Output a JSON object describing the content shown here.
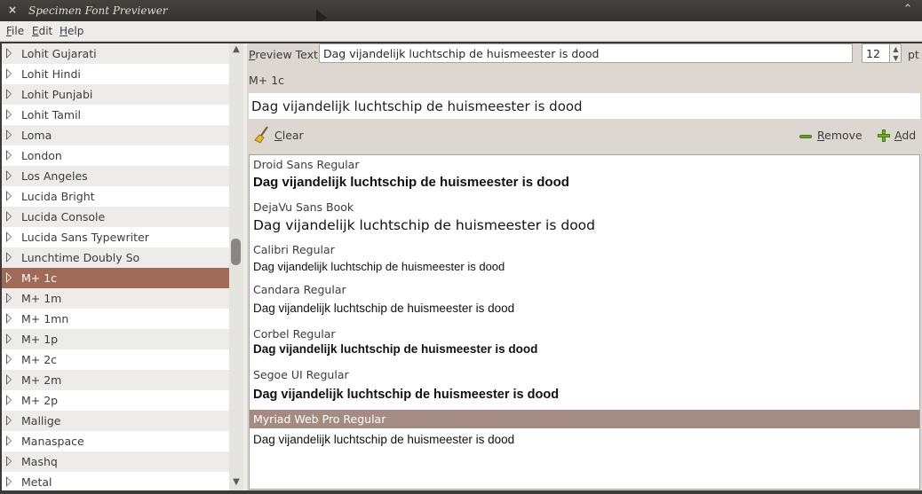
{
  "window": {
    "title": "Specimen Font Previewer",
    "close_glyph": "×",
    "maximize_glyph": "⌃"
  },
  "menubar": {
    "items": [
      {
        "first": "F",
        "rest": "ile"
      },
      {
        "first": "E",
        "rest": "dit"
      },
      {
        "first": "H",
        "rest": "elp"
      }
    ]
  },
  "font_list": {
    "items": [
      "Lohit Gujarati",
      "Lohit Hindi",
      "Lohit Punjabi",
      "Lohit Tamil",
      "Loma",
      "London",
      "Los Angeles",
      "Lucida Bright",
      "Lucida Console",
      "Lucida Sans Typewriter",
      "Lunchtime Doubly So",
      "M+ 1c",
      "M+ 1m",
      "M+ 1mn",
      "M+ 1p",
      "M+ 2c",
      "M+ 2m",
      "M+ 2p",
      "Mallige",
      "Manaspace",
      "Mashq",
      "Metal"
    ],
    "selected": "M+ 1c"
  },
  "preview": {
    "label_first": "P",
    "label_rest": "review Text:",
    "text": "Dag vijandelijk luchtschip de huismeester is dood",
    "size": "12",
    "unit": "pt",
    "selected_font": "M+ 1c",
    "sample": "Dag vijandelijk luchtschip de huismeester is dood"
  },
  "toolbar": {
    "clear_first": "C",
    "clear_rest": "lear",
    "remove_first": "R",
    "remove_rest": "emove",
    "add_first": "A",
    "add_rest": "dd",
    "clear_icon": "broom-icon",
    "remove_icon": "minus-icon",
    "add_icon": "plus-icon"
  },
  "comparison": {
    "items": [
      {
        "font": "Droid Sans Regular",
        "sample": "Dag vijandelijk luchtschip de huismeester is dood"
      },
      {
        "font": "DejaVu Sans Book",
        "sample": "Dag vijandelijk luchtschip de huismeester is dood"
      },
      {
        "font": "Calibri Regular",
        "sample": "Dag vijandelijk luchtschip de huismeester is dood"
      },
      {
        "font": "Candara Regular",
        "sample": "Dag vijandelijk luchtschip de huismeester is dood"
      },
      {
        "font": "Corbel Regular",
        "sample": "Dag vijandelijk luchtschip de huismeester is dood"
      },
      {
        "font": "Segoe UI Regular",
        "sample": "Dag vijandelijk luchtschip de huismeester is dood"
      },
      {
        "font": "Myriad Web Pro Regular",
        "sample": "Dag vijandelijk luchtschip de huismeester is dood"
      }
    ],
    "selected": "Myriad Web Pro Regular"
  },
  "colors": {
    "selection": "#a16a57",
    "selection_alt": "#a58c82",
    "titlebar": "#3c3b37"
  }
}
